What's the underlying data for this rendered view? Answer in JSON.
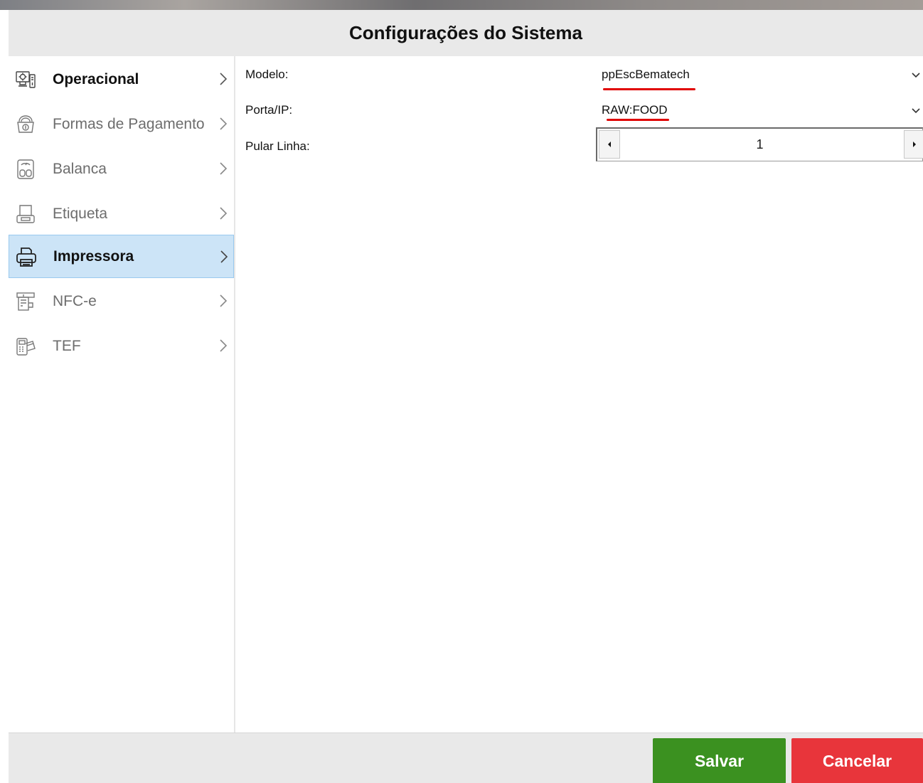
{
  "window": {
    "title": "Configurações do Sistema"
  },
  "sidebar": {
    "items": [
      {
        "label": "Operacional",
        "icon": "settings-computer-icon",
        "active": false,
        "bold": true
      },
      {
        "label": "Formas de Pagamento",
        "icon": "payment-machine-icon",
        "active": false,
        "bold": false
      },
      {
        "label": "Balanca",
        "icon": "scale-icon",
        "active": false,
        "bold": false
      },
      {
        "label": "Etiqueta",
        "icon": "label-printer-icon",
        "active": false,
        "bold": false
      },
      {
        "label": "Impressora",
        "icon": "printer-icon",
        "active": true,
        "bold": true
      },
      {
        "label": "NFC-e",
        "icon": "nfce-terminal-icon",
        "active": false,
        "bold": false
      },
      {
        "label": "TEF",
        "icon": "card-terminal-icon",
        "active": false,
        "bold": false
      }
    ]
  },
  "form": {
    "modelo": {
      "label": "Modelo:",
      "value": "ppEscBematech"
    },
    "porta": {
      "label": "Porta/IP:",
      "value": "RAW:FOOD"
    },
    "pular_linha": {
      "label": "Pular Linha:",
      "value": "1"
    }
  },
  "footer": {
    "save_label": "Salvar",
    "cancel_label": "Cancelar"
  },
  "colors": {
    "title_bar": "#e9e9e9",
    "active_item": "#cce4f7",
    "save_button": "#3b9120",
    "cancel_button": "#e8353b",
    "highlight_underline": "#e00000"
  }
}
